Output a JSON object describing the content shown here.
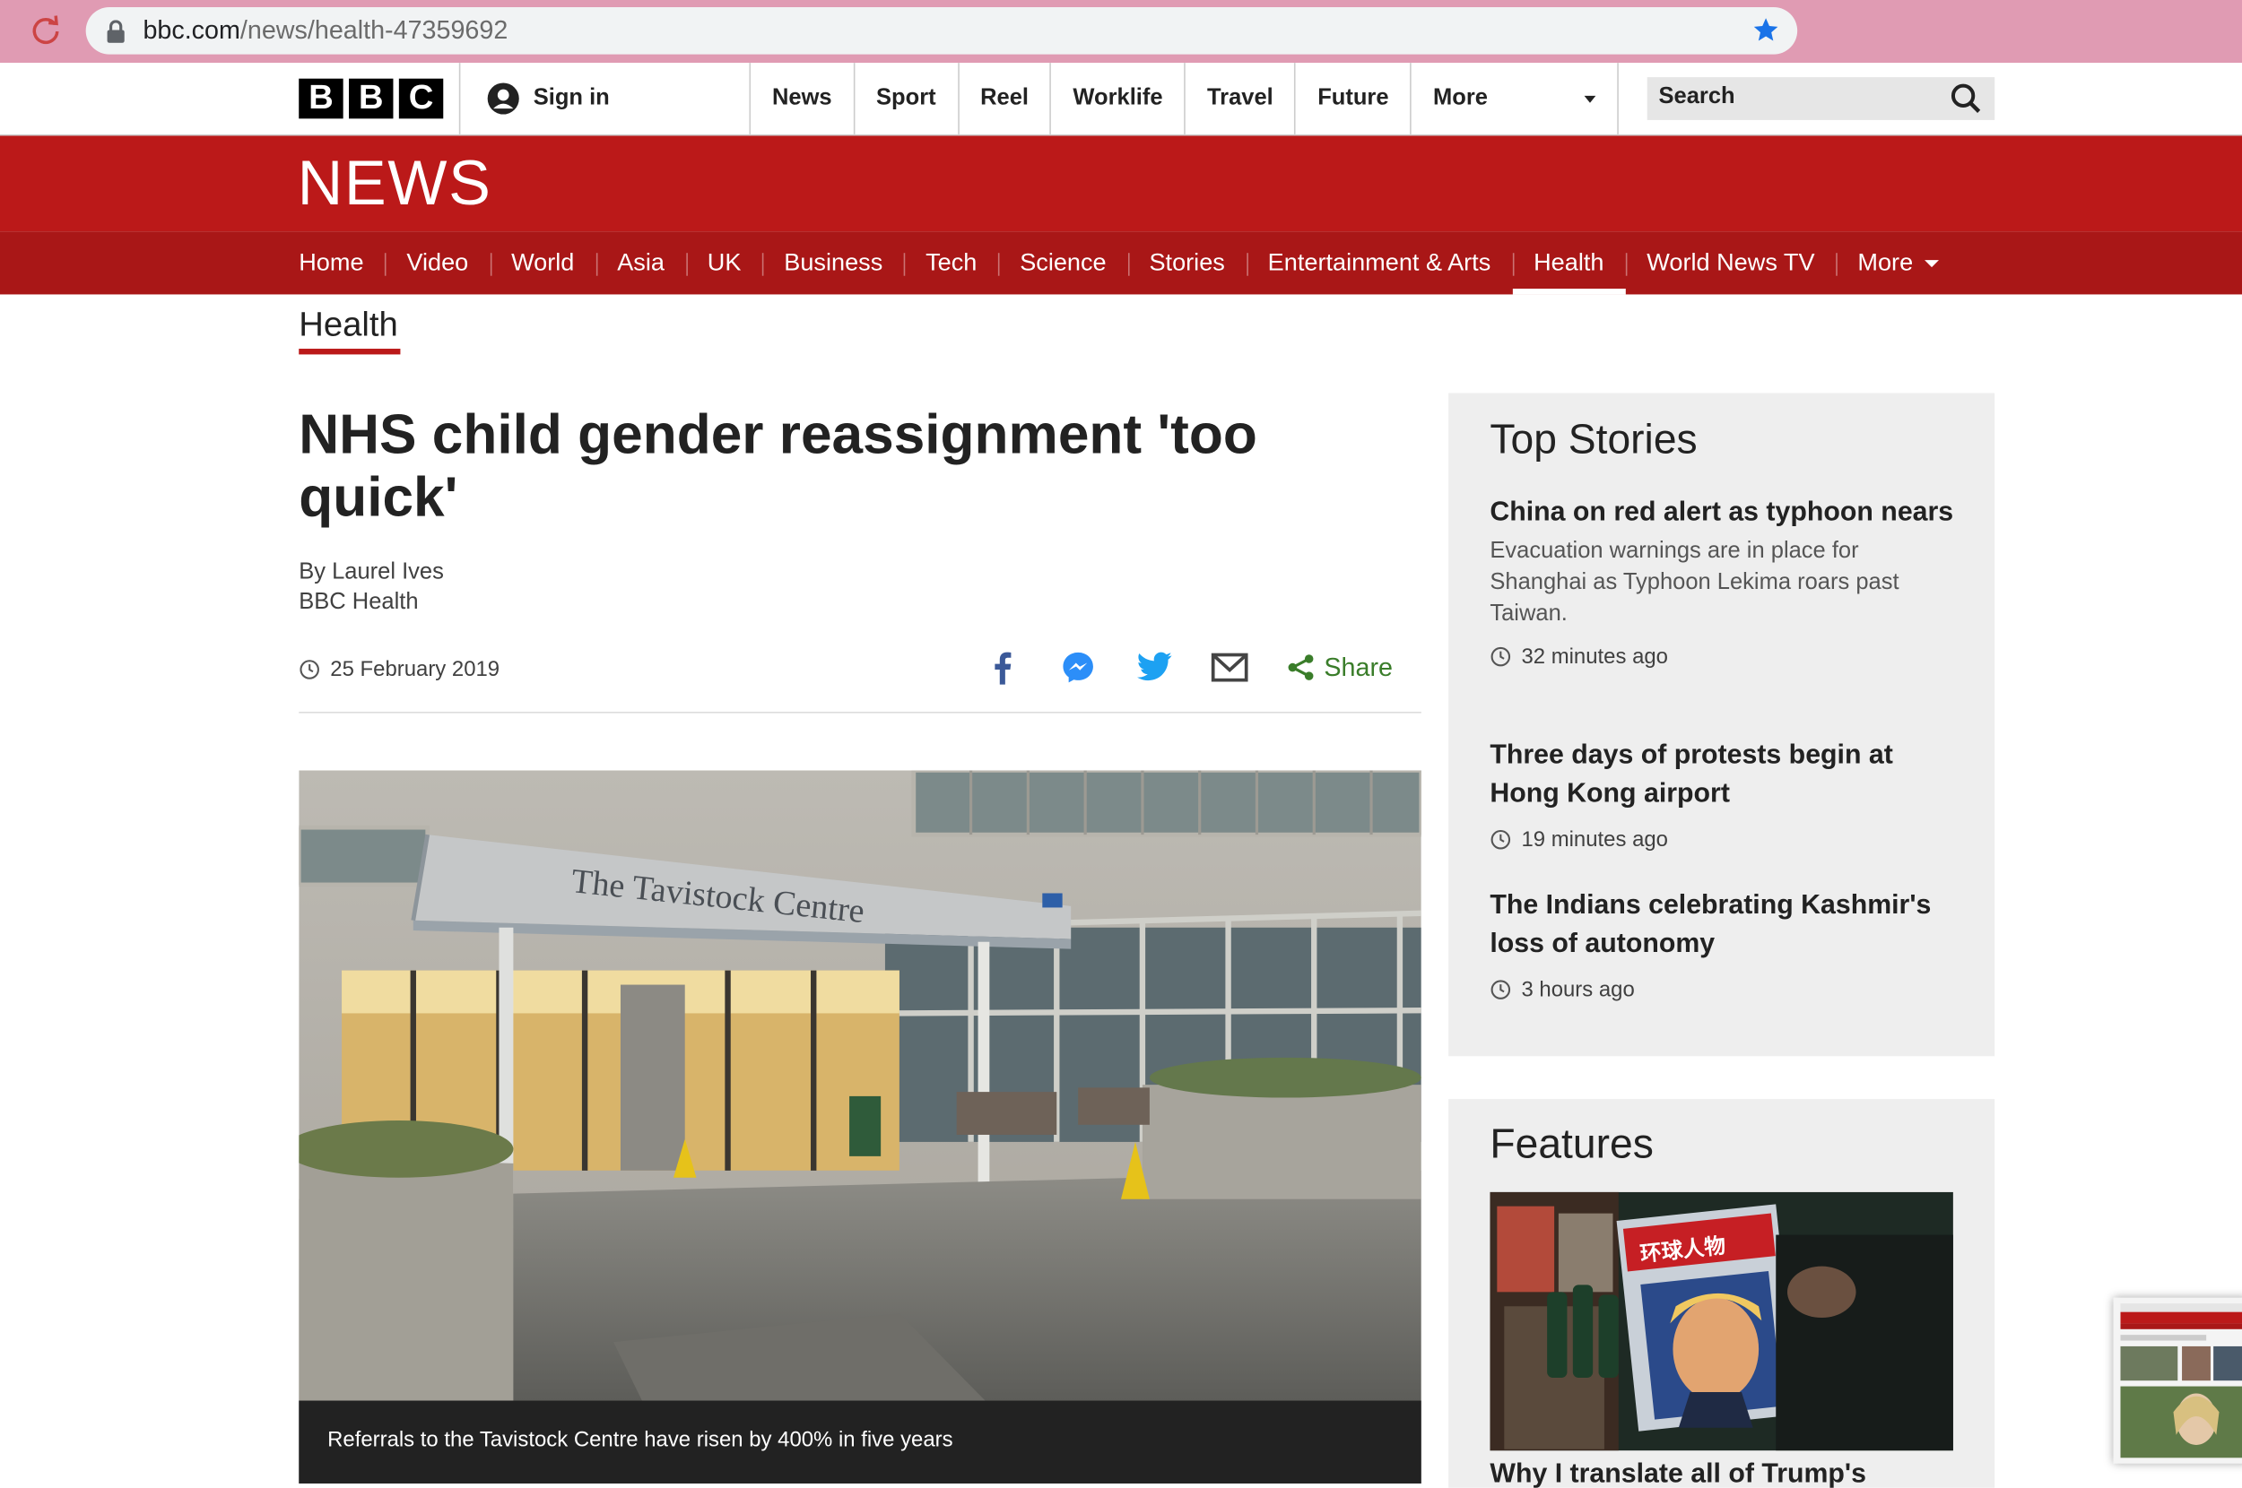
{
  "browser": {
    "url_domain": "bbc.com",
    "url_path": "/news/health-47359692"
  },
  "global_nav": {
    "logo_letters": [
      "B",
      "B",
      "C"
    ],
    "signin_label": "Sign in",
    "items": [
      {
        "label": "News"
      },
      {
        "label": "Sport"
      },
      {
        "label": "Reel"
      },
      {
        "label": "Worklife"
      },
      {
        "label": "Travel"
      },
      {
        "label": "Future"
      }
    ],
    "more_label": "More",
    "search_placeholder": "Search"
  },
  "masthead": {
    "logo_text": "NEWS"
  },
  "news_nav": {
    "items": [
      {
        "label": "Home"
      },
      {
        "label": "Video"
      },
      {
        "label": "World"
      },
      {
        "label": "Asia"
      },
      {
        "label": "UK"
      },
      {
        "label": "Business"
      },
      {
        "label": "Tech"
      },
      {
        "label": "Science"
      },
      {
        "label": "Stories"
      },
      {
        "label": "Entertainment & Arts"
      },
      {
        "label": "Health"
      },
      {
        "label": "World News TV"
      }
    ],
    "active": "Health",
    "more_label": "More"
  },
  "section_title": "Health",
  "article": {
    "headline": "NHS child gender reassignment 'too quick'",
    "author": "By Laurel Ives",
    "author_role": "BBC Health",
    "date": "25 February 2019",
    "share_label": "Share",
    "image_sign_text": "The Tavistock Centre",
    "image_caption": "Referrals to the Tavistock Centre have risen by 400% in five years"
  },
  "top_stories": {
    "title": "Top Stories",
    "stories": [
      {
        "title": "China on red alert as typhoon nears",
        "summary": "Evacuation warnings are in place for Shanghai as Typhoon Lekima roars past Taiwan.",
        "time": "32 minutes ago"
      },
      {
        "title": "Three days of protests begin at Hong Kong airport",
        "summary": "",
        "time": "19 minutes ago"
      },
      {
        "title": "The Indians celebrating Kashmir's loss of autonomy",
        "summary": "",
        "time": "3 hours ago"
      }
    ]
  },
  "features": {
    "title": "Features",
    "magazine_text": "环球人物",
    "story_title": "Why I translate all of Trump's"
  },
  "colors": {
    "bbc_red": "#bb1919",
    "nav_red": "#a91717",
    "chrome_pink": "#e09bb3",
    "share_green": "#3a7d2a",
    "facebook_blue": "#3b5998",
    "messenger_blue": "#2c8ef8",
    "twitter_blue": "#1da1f2"
  },
  "icons": [
    "reload-icon",
    "lock-icon",
    "bookmark-star-icon",
    "user-icon",
    "search-icon",
    "clock-icon",
    "facebook-icon",
    "messenger-icon",
    "twitter-icon",
    "email-icon",
    "share-icon"
  ]
}
